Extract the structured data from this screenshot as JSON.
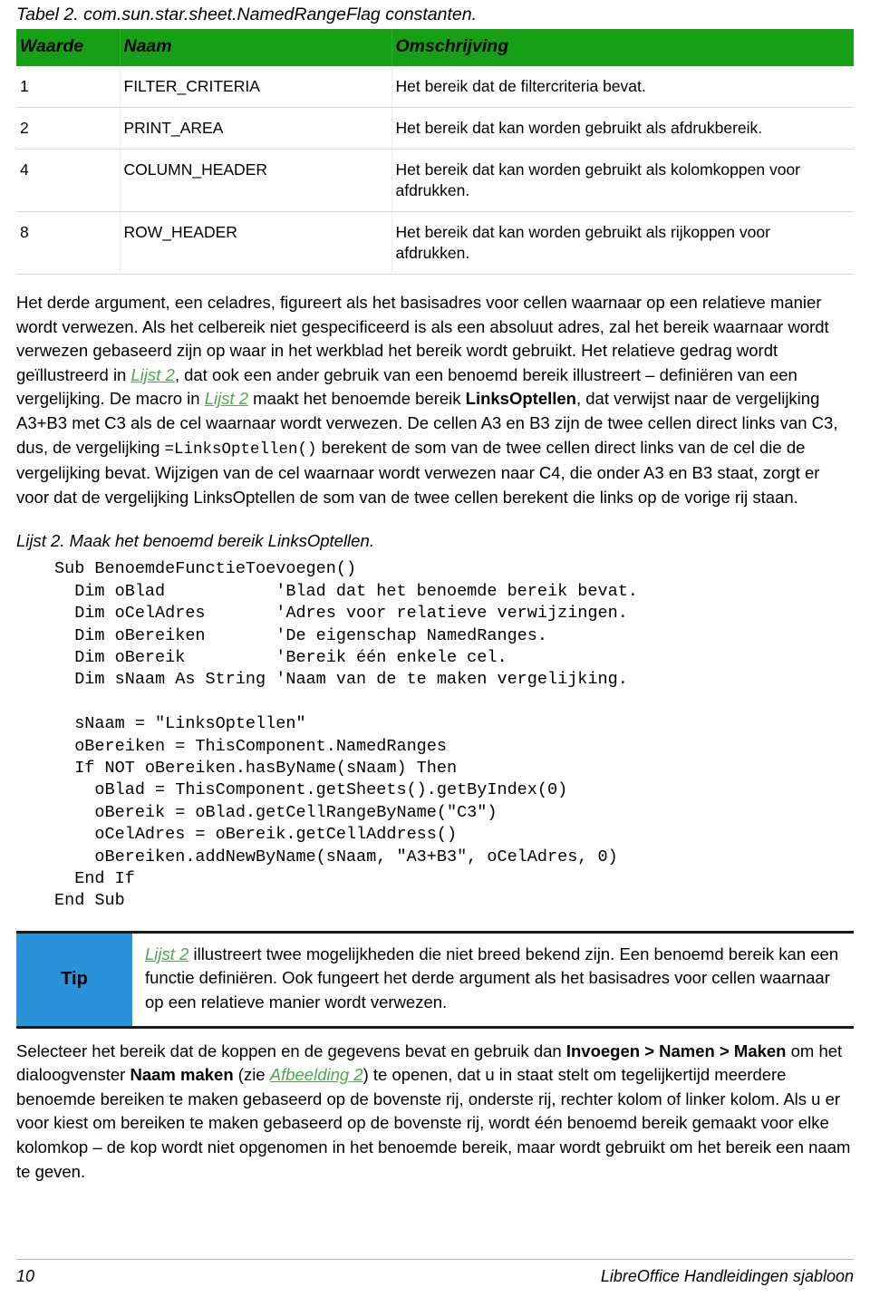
{
  "table": {
    "caption": "Tabel 2. com.sun.star.sheet.NamedRangeFlag constanten.",
    "header_bg": "#16A016",
    "columns": [
      "Waarde",
      "Naam",
      "Omschrijving"
    ],
    "rows": [
      {
        "waarde": "1",
        "naam": "FILTER_CRITERIA",
        "omschrijving": "Het bereik dat de filtercriteria bevat."
      },
      {
        "waarde": "2",
        "naam": "PRINT_AREA",
        "omschrijving": "Het bereik dat kan worden gebruikt als afdrukbereik."
      },
      {
        "waarde": "4",
        "naam": "COLUMN_HEADER",
        "omschrijving": "Het bereik dat kan worden gebruikt als kolomkoppen voor afdrukken."
      },
      {
        "waarde": "8",
        "naam": "ROW_HEADER",
        "omschrijving": "Het bereik dat kan worden gebruikt als rijkoppen voor afdrukken."
      }
    ]
  },
  "paragraph1": {
    "part1": "Het derde argument, een celadres, figureert als het basisadres voor cellen waarnaar op een relatieve manier wordt verwezen. Als het celbereik niet gespecificeerd is als een absoluut adres, zal het bereik waarnaar wordt verwezen gebaseerd zijn op waar in het werkblad het bereik wordt gebruikt. Het relatieve gedrag wordt geïllustreerd in ",
    "link1": "Lijst 2",
    "part2": ", dat ook een ander gebruik van een benoemd bereik illustreert – definiëren van een vergelijking. De macro in ",
    "link2": "Lijst 2",
    "part3": " maakt het benoemde bereik ",
    "bold1": "LinksOptellen",
    "part4": ", dat verwijst naar de vergelijking A3+B3 met C3 als de cel waarnaar wordt verwezen. De cellen A3 en B3 zijn de twee cellen direct links van C3, dus, de vergelijking ",
    "code1": "=LinksOptellen()",
    "part5": " berekent de som van de twee cellen direct links van de cel die de vergelijking bevat. Wijzigen van de cel waarnaar wordt verwezen naar C4, die onder A3 en B3 staat, zorgt er voor dat de vergelijking LinksOptellen de som van de twee cellen berekent die links op de vorige rij staan."
  },
  "listing": {
    "caption": "Lijst 2. Maak het benoemd bereik LinksOptellen.",
    "code": "Sub BenoemdeFunctieToevoegen()\n  Dim oBlad           'Blad dat het benoemde bereik bevat.\n  Dim oCelAdres       'Adres voor relatieve verwijzingen.\n  Dim oBereiken       'De eigenschap NamedRanges.\n  Dim oBereik         'Bereik één enkele cel.\n  Dim sNaam As String 'Naam van de te maken vergelijking.\n\n  sNaam = \"LinksOptellen\"\n  oBereiken = ThisComponent.NamedRanges\n  If NOT oBereiken.hasByName(sNaam) Then\n    oBlad = ThisComponent.getSheets().getByIndex(0)\n    oBereik = oBlad.getCellRangeByName(\"C3\")\n    oCelAdres = oBereik.getCellAddress()\n    oBereiken.addNewByName(sNaam, \"A3+B3\", oCelAdres, 0)\n  End If\nEnd Sub"
  },
  "tip": {
    "label": "Tip",
    "accent": "#2A92D8",
    "link": "Lijst 2",
    "text": " illustreert twee mogelijkheden die niet breed bekend zijn. Een benoemd bereik kan een functie definiëren. Ook fungeert het derde argument als het basisadres voor cellen waarnaar op een relatieve manier wordt verwezen."
  },
  "paragraph2": {
    "part1": "Selecteer het bereik dat de koppen en de gegevens bevat en gebruik dan ",
    "bold1": "Invoegen > Namen > Maken",
    "part2": " om het dialoogvenster ",
    "bold2": "Naam maken",
    "part3": " (zie ",
    "link1": "Afbeelding 2",
    "part4": ") te openen, dat u in staat stelt om tegelijkertijd meerdere benoemde bereiken te maken gebaseerd op de bovenste rij, onderste rij, rechter kolom of linker kolom. Als u er voor kiest om bereiken te maken gebaseerd op de bovenste rij, wordt één benoemd bereik gemaakt voor elke kolomkop – de kop wordt niet opgenomen in het benoemde bereik, maar wordt gebruikt om het bereik een naam te geven."
  },
  "footer": {
    "page_number": "10",
    "doc_title": "LibreOffice Handleidingen sjabloon"
  }
}
